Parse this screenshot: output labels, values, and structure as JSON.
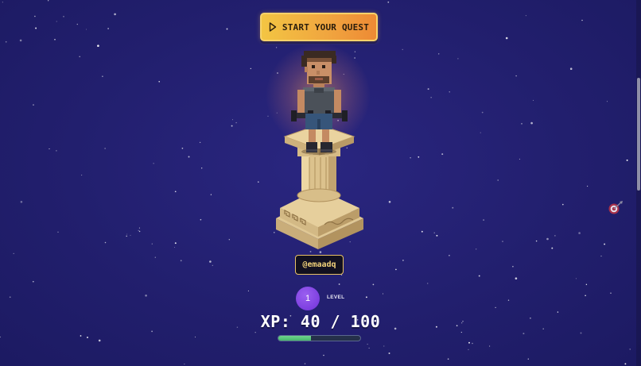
{
  "hero": {
    "start_button_label": "START YOUR QUEST",
    "start_button_icon": "play-icon",
    "avatar": "pixel-art-character",
    "pedestal": "greek-column-pedestal"
  },
  "player": {
    "username": "@emaadq",
    "level": "1",
    "level_label": "LEVEL",
    "xp_text": "XP: 40 / 100",
    "xp_current": 40,
    "xp_max": 100
  },
  "side": {
    "target_icon": "target-arrow-icon"
  },
  "colors": {
    "background": "#221f6e",
    "button": "#f3b23f",
    "level_badge": "#7d3fe0",
    "xp_fill": "#52c074",
    "username_border": "#e9c265"
  }
}
